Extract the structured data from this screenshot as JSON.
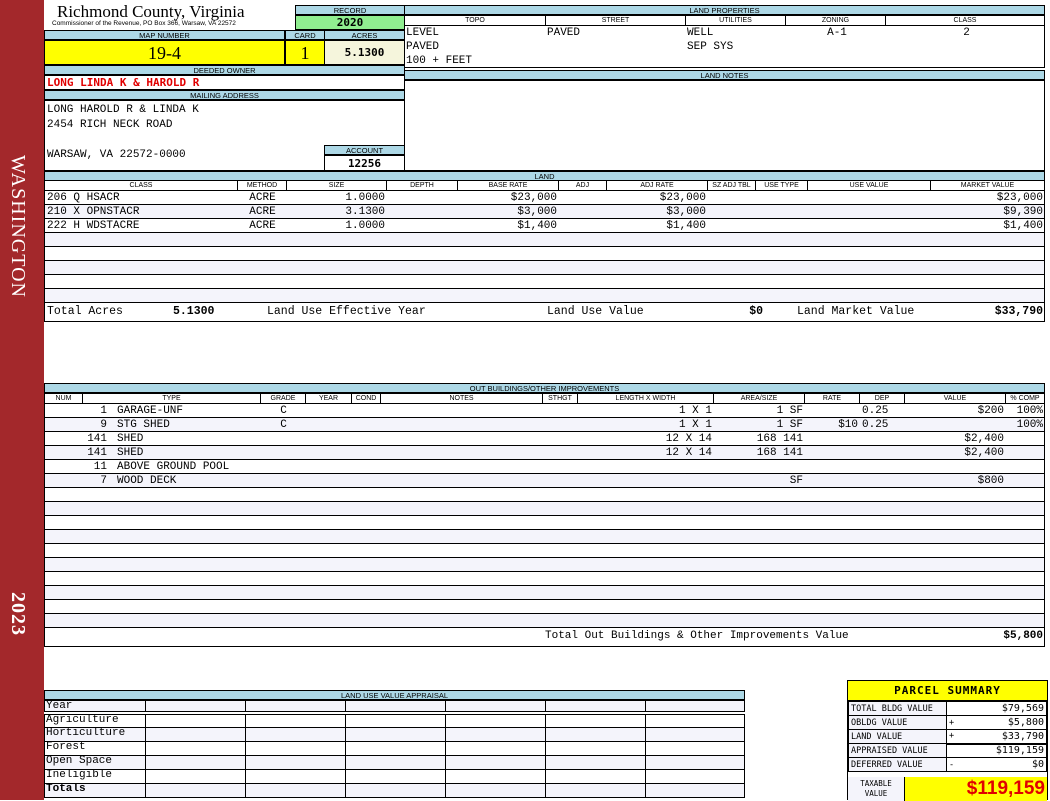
{
  "sidebar": {
    "district": "WASHINGTON",
    "year": "2023",
    "color": "#a3282b"
  },
  "header": {
    "title": "Richmond County, Virginia",
    "subtitle": "Commissioner of the Revenue, PO Box 366, Warsaw, VA 22572",
    "record_label": "RECORD",
    "record_value": "2020"
  },
  "parcel": {
    "map_number_label": "MAP NUMBER",
    "map_number": "19-4",
    "card_label": "CARD",
    "card": "1",
    "acres_label": "ACRES",
    "acres": "5.1300"
  },
  "owner": {
    "label": "DEEDED OWNER",
    "name": "LONG LINDA K & HAROLD R"
  },
  "mailing": {
    "label": "MAILING ADDRESS",
    "lines": [
      "LONG HAROLD R & LINDA K",
      "2454 RICH NECK ROAD",
      "",
      "WARSAW, VA 22572-0000"
    ],
    "account_label": "ACCOUNT",
    "account": "12256"
  },
  "land_properties": {
    "label": "LAND PROPERTIES",
    "columns": [
      "TOPO",
      "STREET",
      "UTILITIES",
      "ZONING",
      "CLASS"
    ],
    "topo": [
      "LEVEL",
      "PAVED",
      "100 + FEET"
    ],
    "street": [
      "PAVED"
    ],
    "utilities": [
      "WELL",
      "SEP SYS"
    ],
    "zoning": [
      "A-1"
    ],
    "class": [
      "2"
    ]
  },
  "land_notes": {
    "label": "LAND NOTES"
  },
  "land": {
    "label": "LAND",
    "columns": [
      "CLASS",
      "METHOD",
      "SIZE",
      "DEPTH",
      "BASE RATE",
      "ADJ",
      "ADJ RATE",
      "SZ ADJ TBL",
      "USE TYPE",
      "USE VALUE",
      "MARKET VALUE"
    ],
    "rows": [
      [
        "206 Q HSACR",
        "ACRE",
        "1.0000",
        "",
        "$23,000",
        "",
        "$23,000",
        "",
        "",
        "",
        "$23,000"
      ],
      [
        "210 X OPNSTACR",
        "ACRE",
        "3.1300",
        "",
        "$3,000",
        "",
        "$3,000",
        "",
        "",
        "",
        "$9,390"
      ],
      [
        "222 H WDSTACRE",
        "ACRE",
        "1.0000",
        "",
        "$1,400",
        "",
        "$1,400",
        "",
        "",
        "",
        "$1,400"
      ]
    ],
    "totals": {
      "total_acres_label": "Total Acres",
      "total_acres": "5.1300",
      "effective_year_label": "Land Use Effective Year",
      "use_value_label": "Land Use Value",
      "use_value": "$0",
      "market_value_label": "Land Market Value",
      "market_value": "$33,790"
    }
  },
  "outbuildings": {
    "label": "OUT BUILDINGS/OTHER IMPROVEMENTS",
    "columns": [
      "NUM",
      "TYPE",
      "GRADE",
      "YEAR",
      "COND",
      "NOTES",
      "STHGT",
      "LENGTH X WIDTH",
      "AREA/SIZE",
      "RATE",
      "DEP",
      "VALUE",
      "% COMP"
    ],
    "rows": [
      [
        "1",
        "GARAGE-UNF",
        "C",
        "",
        "",
        "",
        "",
        "1 X 1",
        "1 SF",
        "",
        "0.25",
        "$200",
        "100%"
      ],
      [
        "9",
        "STG SHED",
        "C",
        "",
        "",
        "",
        "",
        "1 X 1",
        "1 SF",
        "$10",
        "0.25",
        "",
        "100%"
      ],
      [
        "141",
        "SHED",
        "",
        "",
        "",
        "",
        "",
        "12 X 14",
        "168 141",
        "",
        "",
        "$2,400",
        ""
      ],
      [
        "141",
        "SHED",
        "",
        "",
        "",
        "",
        "",
        "12 X 14",
        "168 141",
        "",
        "",
        "$2,400",
        ""
      ],
      [
        "11",
        "ABOVE GROUND POOL",
        "",
        "",
        "",
        "",
        "",
        "",
        "",
        "",
        "",
        "",
        ""
      ],
      [
        "7",
        "WOOD DECK",
        "",
        "",
        "",
        "",
        "",
        "",
        "SF",
        "",
        "",
        "$800",
        ""
      ]
    ],
    "total_label": "Total Out Buildings & Other Improvements Value",
    "total": "$5,800"
  },
  "land_use_appraisal": {
    "label": "LAND USE VALUE APPRAISAL",
    "year_label": "Year",
    "rows": [
      "Agriculture",
      "Horticulture",
      "Forest",
      "Open Space",
      "Ineligible"
    ],
    "totals_label": "Totals"
  },
  "parcel_summary": {
    "title": "PARCEL SUMMARY",
    "rows": [
      {
        "label": "TOTAL BLDG VALUE",
        "sign": "",
        "value": "$79,569"
      },
      {
        "label": "OBLDG VALUE",
        "sign": "+",
        "value": "$5,800"
      },
      {
        "label": "LAND VALUE",
        "sign": "+",
        "value": "$33,790"
      },
      {
        "label": "APPRAISED VALUE",
        "sign": "",
        "value": "$119,159"
      },
      {
        "label": "DEFERRED VALUE",
        "sign": "-",
        "value": "$0"
      }
    ],
    "taxable_label": "TAXABLE VALUE",
    "taxable_value": "$119,159"
  }
}
